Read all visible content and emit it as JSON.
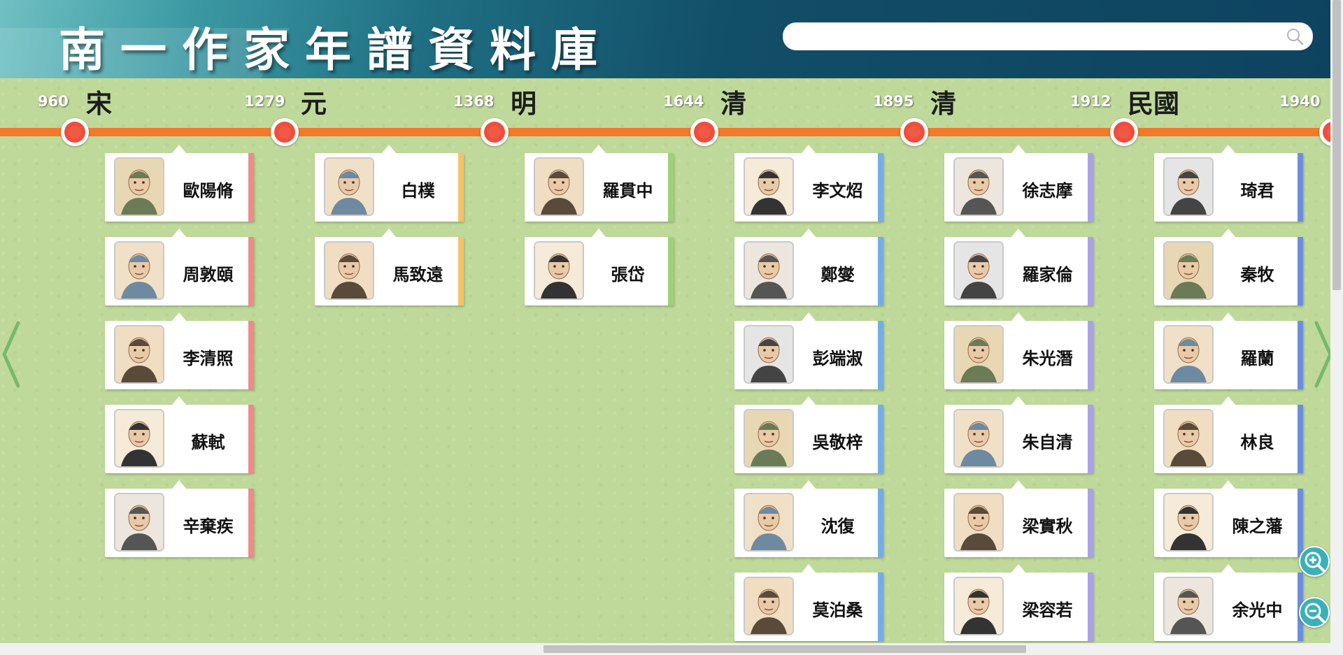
{
  "app": {
    "title": "南一作家年譜資料庫"
  },
  "search": {
    "value": "",
    "placeholder": ""
  },
  "colors": {
    "song": "#ef8a8a",
    "yuan": "#f3c26a",
    "ming": "#9bd27a",
    "qing": "#74aee6",
    "qing2": "#a9a3e6",
    "minguo": "#6b8fdb",
    "timeline": "#f27a2a",
    "node": "#ef4e3c"
  },
  "timeline": {
    "years": [
      "960",
      "1279",
      "1368",
      "1644",
      "1895",
      "1912",
      "1940"
    ],
    "eras": [
      "宋",
      "元",
      "明",
      "清",
      "清",
      "民國"
    ]
  },
  "columns": [
    {
      "era": "宋",
      "color": "#ef8a8a",
      "authors": [
        {
          "name": "歐陽脩",
          "icon": "portrait-icon"
        },
        {
          "name": "周敦頤",
          "icon": "portrait-icon"
        },
        {
          "name": "李清照",
          "icon": "portrait-icon"
        },
        {
          "name": "蘇軾",
          "icon": "portrait-icon"
        },
        {
          "name": "辛棄疾",
          "icon": "portrait-icon"
        }
      ]
    },
    {
      "era": "元",
      "color": "#f3c26a",
      "authors": [
        {
          "name": "白樸",
          "icon": "portrait-icon"
        },
        {
          "name": "馬致遠",
          "icon": "portrait-icon"
        }
      ]
    },
    {
      "era": "明",
      "color": "#9bd27a",
      "authors": [
        {
          "name": "羅貫中",
          "icon": "portrait-icon"
        },
        {
          "name": "張岱",
          "icon": "portrait-icon"
        }
      ]
    },
    {
      "era": "清",
      "color": "#74aee6",
      "authors": [
        {
          "name": "李文炤",
          "icon": "portrait-icon"
        },
        {
          "name": "鄭燮",
          "icon": "portrait-icon"
        },
        {
          "name": "彭端淑",
          "icon": "portrait-icon"
        },
        {
          "name": "吳敬梓",
          "icon": "portrait-icon"
        },
        {
          "name": "沈復",
          "icon": "portrait-icon"
        },
        {
          "name": "莫泊桑",
          "icon": "portrait-icon"
        }
      ]
    },
    {
      "era": "清",
      "color": "#a9a3e6",
      "authors": [
        {
          "name": "徐志摩",
          "icon": "portrait-icon"
        },
        {
          "name": "羅家倫",
          "icon": "portrait-icon"
        },
        {
          "name": "朱光潛",
          "icon": "portrait-icon"
        },
        {
          "name": "朱自清",
          "icon": "portrait-icon"
        },
        {
          "name": "梁實秋",
          "icon": "portrait-icon"
        },
        {
          "name": "梁容若",
          "icon": "portrait-icon"
        }
      ]
    },
    {
      "era": "民國",
      "color": "#6b8fdb",
      "authors": [
        {
          "name": "琦君",
          "icon": "portrait-icon"
        },
        {
          "name": "秦牧",
          "icon": "portrait-icon"
        },
        {
          "name": "羅蘭",
          "icon": "portrait-icon"
        },
        {
          "name": "林良",
          "icon": "portrait-icon"
        },
        {
          "name": "陳之藩",
          "icon": "portrait-icon"
        },
        {
          "name": "余光中",
          "icon": "portrait-icon"
        }
      ]
    }
  ],
  "controls": {
    "prev": "chevron-left-icon",
    "next": "chevron-right-icon",
    "zoom_in": "zoom-in-icon",
    "zoom_out": "zoom-out-icon"
  }
}
